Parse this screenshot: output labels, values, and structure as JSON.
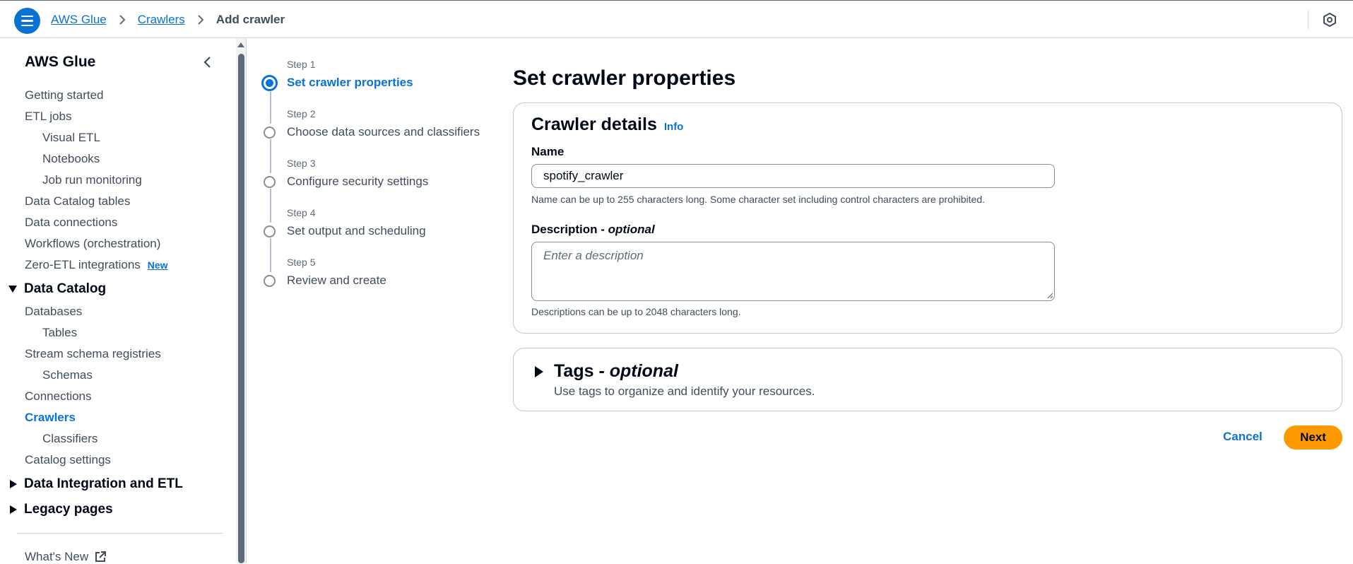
{
  "breadcrumb": {
    "items": [
      "AWS Glue",
      "Crawlers"
    ],
    "current": "Add crawler"
  },
  "sidebar": {
    "title": "AWS Glue",
    "top_items": [
      "Getting started",
      "ETL jobs",
      "Visual ETL",
      "Notebooks",
      "Job run monitoring",
      "Data Catalog tables",
      "Data connections",
      "Workflows (orchestration)",
      "Zero-ETL integrations"
    ],
    "new_badge": "New",
    "data_catalog": {
      "label": "Data Catalog",
      "items": [
        "Databases",
        "Tables",
        "Stream schema registries",
        "Schemas",
        "Connections",
        "Crawlers",
        "Classifiers",
        "Catalog settings"
      ]
    },
    "sections": [
      "Data Integration and ETL",
      "Legacy pages"
    ],
    "whats_new": "What's New"
  },
  "steps": [
    {
      "label": "Step 1",
      "name": "Set crawler properties"
    },
    {
      "label": "Step 2",
      "name": "Choose data sources and classifiers"
    },
    {
      "label": "Step 3",
      "name": "Configure security settings"
    },
    {
      "label": "Step 4",
      "name": "Set output and scheduling"
    },
    {
      "label": "Step 5",
      "name": "Review and create"
    }
  ],
  "main": {
    "title": "Set crawler properties",
    "details": {
      "header": "Crawler details",
      "info": "Info",
      "name_label": "Name",
      "name_value": "spotify_crawler",
      "name_hint": "Name can be up to 255 characters long. Some character set including control characters are prohibited.",
      "desc_label": "Description - ",
      "desc_optional": "optional",
      "desc_placeholder": "Enter a description",
      "desc_hint": "Descriptions can be up to 2048 characters long."
    },
    "tags": {
      "title": "Tags - ",
      "optional": "optional",
      "description": "Use tags to organize and identify your resources."
    },
    "cancel": "Cancel",
    "next": "Next"
  },
  "colors": {
    "accent": "#0972d3",
    "primary_button": "#ff9900"
  }
}
